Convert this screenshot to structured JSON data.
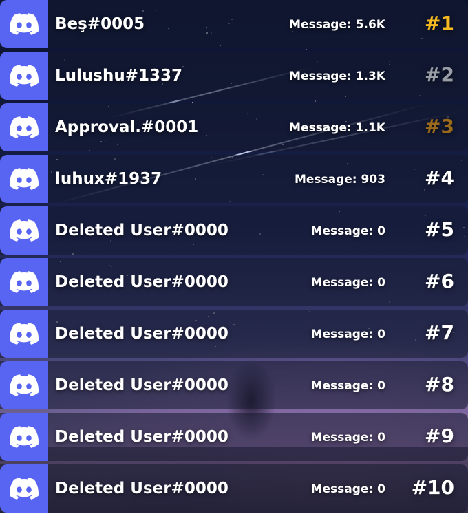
{
  "leaderboard": {
    "colors": {
      "logo_bg": "#5865f2",
      "rank_default": "#ffffff",
      "gold": "#f5b921",
      "silver": "#9a9ea6",
      "bronze": "#9a6a1a"
    },
    "entries": [
      {
        "user": "Beş#0005",
        "messages": "Message: 5.6K",
        "rank": "#1",
        "rank_color": "#f5b921",
        "icon": "discord-icon"
      },
      {
        "user": "Lulushu#1337",
        "messages": "Message: 1.3K",
        "rank": "#2",
        "rank_color": "#9a9ea6",
        "icon": "discord-icon"
      },
      {
        "user": "Approval.#0001",
        "messages": "Message: 1.1K",
        "rank": "#3",
        "rank_color": "#9a6a1a",
        "icon": "discord-icon"
      },
      {
        "user": "luhux#1937",
        "messages": "Message: 903",
        "rank": "#4",
        "rank_color": "#ffffff",
        "icon": "discord-icon"
      },
      {
        "user": "Deleted User#0000",
        "messages": "Message: 0",
        "rank": "#5",
        "rank_color": "#ffffff",
        "icon": "discord-icon"
      },
      {
        "user": "Deleted User#0000",
        "messages": "Message: 0",
        "rank": "#6",
        "rank_color": "#ffffff",
        "icon": "discord-icon"
      },
      {
        "user": "Deleted User#0000",
        "messages": "Message: 0",
        "rank": "#7",
        "rank_color": "#ffffff",
        "icon": "discord-icon"
      },
      {
        "user": "Deleted User#0000",
        "messages": "Message: 0",
        "rank": "#8",
        "rank_color": "#ffffff",
        "icon": "discord-icon"
      },
      {
        "user": "Deleted User#0000",
        "messages": "Message: 0",
        "rank": "#9",
        "rank_color": "#ffffff",
        "icon": "discord-icon"
      },
      {
        "user": "Deleted User#0000",
        "messages": "Message: 0",
        "rank": "#10",
        "rank_color": "#ffffff",
        "icon": "discord-icon"
      }
    ]
  }
}
